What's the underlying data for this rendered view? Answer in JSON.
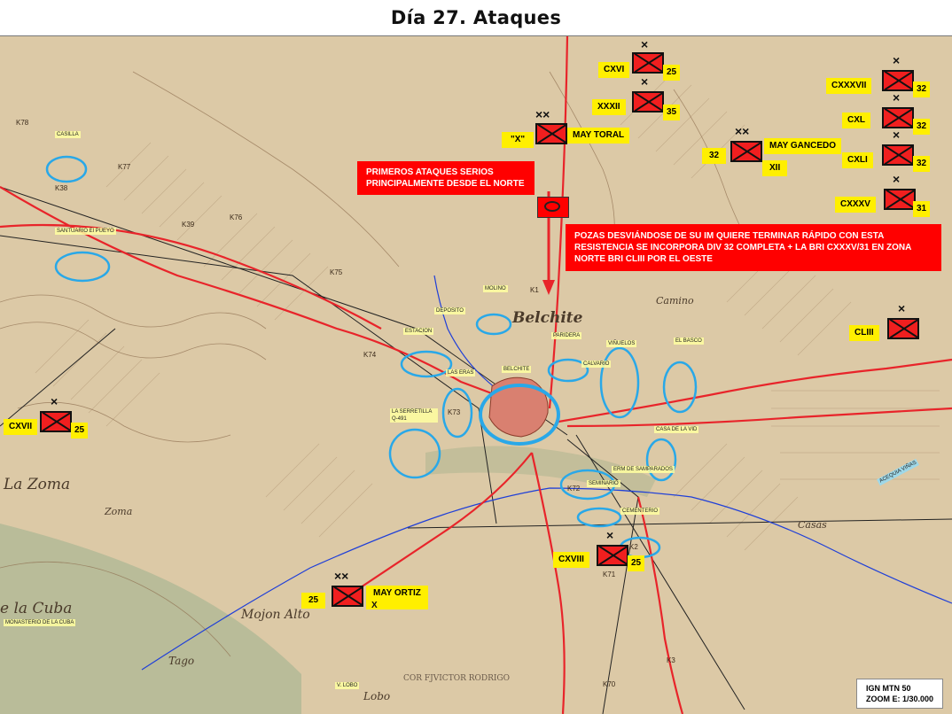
{
  "title": "Día 27. Ataques",
  "notes": {
    "first_attacks": "PRIMEROS ATAQUES SERIOS PRINCIPALMENTE DESDE EL NORTE",
    "pozas": "POZAS DESVIÁNDOSE DE SU IM QUIERE TERMINAR RÁPIDO CON ESTA RESISTENCIA SE INCORPORA DIV 32 COMPLETA + LA BRI CXXXV/31 EN ZONA NORTE BRI CLIII POR EL OESTE"
  },
  "units": {
    "cxvi": {
      "name": "CXVI",
      "num": "25"
    },
    "xxxii": {
      "name": "XXXII",
      "num": "35"
    },
    "x": {
      "name": "\"X\"",
      "commander": "MAY TORAL"
    },
    "gancedo": {
      "num": "32",
      "commander": "MAY GANCEDO",
      "sub": "XII"
    },
    "cxxxvii": {
      "name": "CXXXVII",
      "num": "32"
    },
    "cxl": {
      "name": "CXL",
      "num": "32"
    },
    "cxli": {
      "name": "CXLI",
      "num": "32"
    },
    "cxxxv": {
      "name": "CXXXV",
      "num": "31"
    },
    "cliii": {
      "name": "CLIII"
    },
    "cxvii": {
      "name": "CXVII",
      "num": "25"
    },
    "cxviii": {
      "name": "CXVIII",
      "num": "25"
    },
    "ortiz": {
      "num": "25",
      "commander": "MAY ORTIZ",
      "sub": "X"
    }
  },
  "places": {
    "casilla": "CASILLA",
    "santuario": "SANTUARIO El PUEYO",
    "molino": "MOLINO",
    "deposito": "DEPOSITO",
    "estacion": "ESTACION",
    "parideras": "PARIDERA",
    "viñuelos": "VIÑUELOS",
    "calvario": "CALVARIO",
    "el_basco": "EL BASCO",
    "belchite": "BELCHITE",
    "las_eras": "LAS ERAS",
    "serretilla": "LA SERRETILLA Q-491",
    "casa_del_vino": "CASA DE LA VID",
    "ermita": "ERM DE SAMPARADOS",
    "seminario": "SEMINARIO",
    "cementerio": "CEMENTERIO",
    "monasterio": "MONASTERIO DE LA CUBA",
    "lobo": "V. LOBO",
    "acequia": "ACEQUIA VIÑAS"
  },
  "map_text": {
    "belchite": "Belchite",
    "la_zoma": "La Zoma",
    "zoma": "Zoma",
    "la_cuba": "e la Cuba",
    "mojon": "Mojon Alto",
    "tago": "Tago",
    "lobo": "Lobo",
    "credit": "COR FJVICTOR RODRIGO",
    "camino": "Camino",
    "casas": "Casas"
  },
  "km_marks": [
    "K78",
    "K77",
    "K38",
    "K76",
    "K75",
    "K74",
    "K73",
    "K72",
    "K71",
    "K70",
    "K39",
    "K1",
    "K2",
    "K3"
  ],
  "legend": {
    "line1": "IGN MTN 50",
    "line2": "ZOOM E: 1/30.000"
  },
  "colors": {
    "terrain": "#dcc9a6",
    "road": "#e8242a",
    "river": "#1f3fd8",
    "ellipse": "#29a8e8",
    "unit": "#f01f1f",
    "label": "#ffef00"
  }
}
